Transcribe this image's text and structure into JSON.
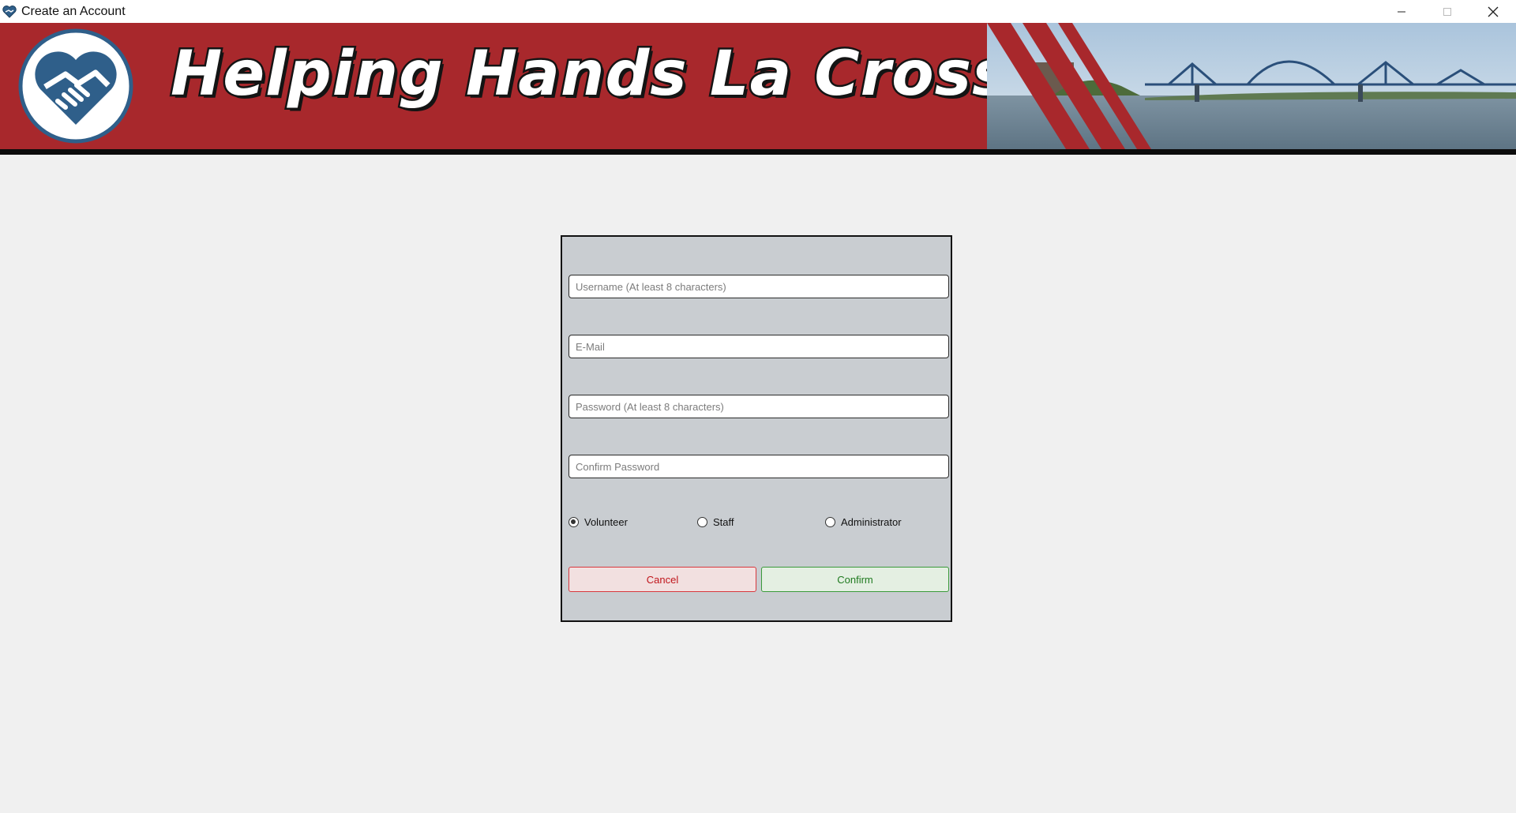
{
  "window": {
    "title": "Create an Account",
    "controls": [
      "minimize-icon",
      "maximize-icon",
      "close-icon"
    ]
  },
  "banner": {
    "title": "Helping Hands La Crosse",
    "colors": {
      "background": "#a8282c",
      "stripe": "#0c0c0c",
      "logo_blue": "#2f5f8a"
    }
  },
  "form": {
    "username_placeholder": "Username (At least 8 characters)",
    "email_placeholder": "E-Mail",
    "password_placeholder": "Password (At least 8 characters)",
    "confirm_password_placeholder": "Confirm Password",
    "roles": [
      {
        "label": "Volunteer",
        "selected": true
      },
      {
        "label": "Staff",
        "selected": false
      },
      {
        "label": "Administrator",
        "selected": false
      }
    ],
    "cancel_label": "Cancel",
    "confirm_label": "Confirm",
    "colors": {
      "panel": "#c9cdd1",
      "cancel": "#c0151b",
      "confirm": "#1f7a1f"
    }
  }
}
